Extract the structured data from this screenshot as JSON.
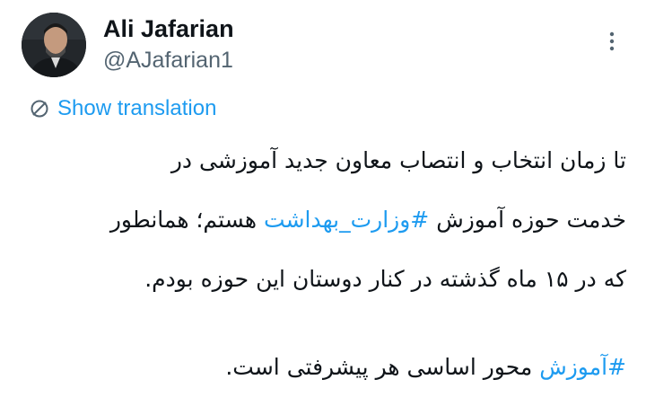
{
  "tweet": {
    "author": {
      "display_name": "Ali Jafarian",
      "handle": "@AJafarian1"
    },
    "more_icon": "more-vertical-icon",
    "translate": {
      "icon": "globe-icon",
      "label": "Show translation"
    },
    "lines": [
      {
        "parts": [
          {
            "text": "تا زمان انتخاب و انتصاب معاون جدید آموزشی در",
            "hashtag": false
          }
        ]
      },
      {
        "parts": [
          {
            "text": "خدمت حوزه آموزش ",
            "hashtag": false
          },
          {
            "text": "#وزارت_بهداشت",
            "hashtag": true
          },
          {
            "text": " هستم؛ همانطور",
            "hashtag": false
          }
        ]
      },
      {
        "parts": [
          {
            "text": "که در ۱۵ ماه گذشته در کنار دوستان این حوزه بودم.",
            "hashtag": false
          }
        ]
      },
      {
        "parts": []
      },
      {
        "parts": [
          {
            "text": "#آموزش",
            "hashtag": true
          },
          {
            "text": " محور اساسی هر پیشرفتی است.",
            "hashtag": false
          }
        ]
      }
    ]
  },
  "colors": {
    "link": "#1d9bf0",
    "text": "#0f1419",
    "secondary": "#536471"
  }
}
